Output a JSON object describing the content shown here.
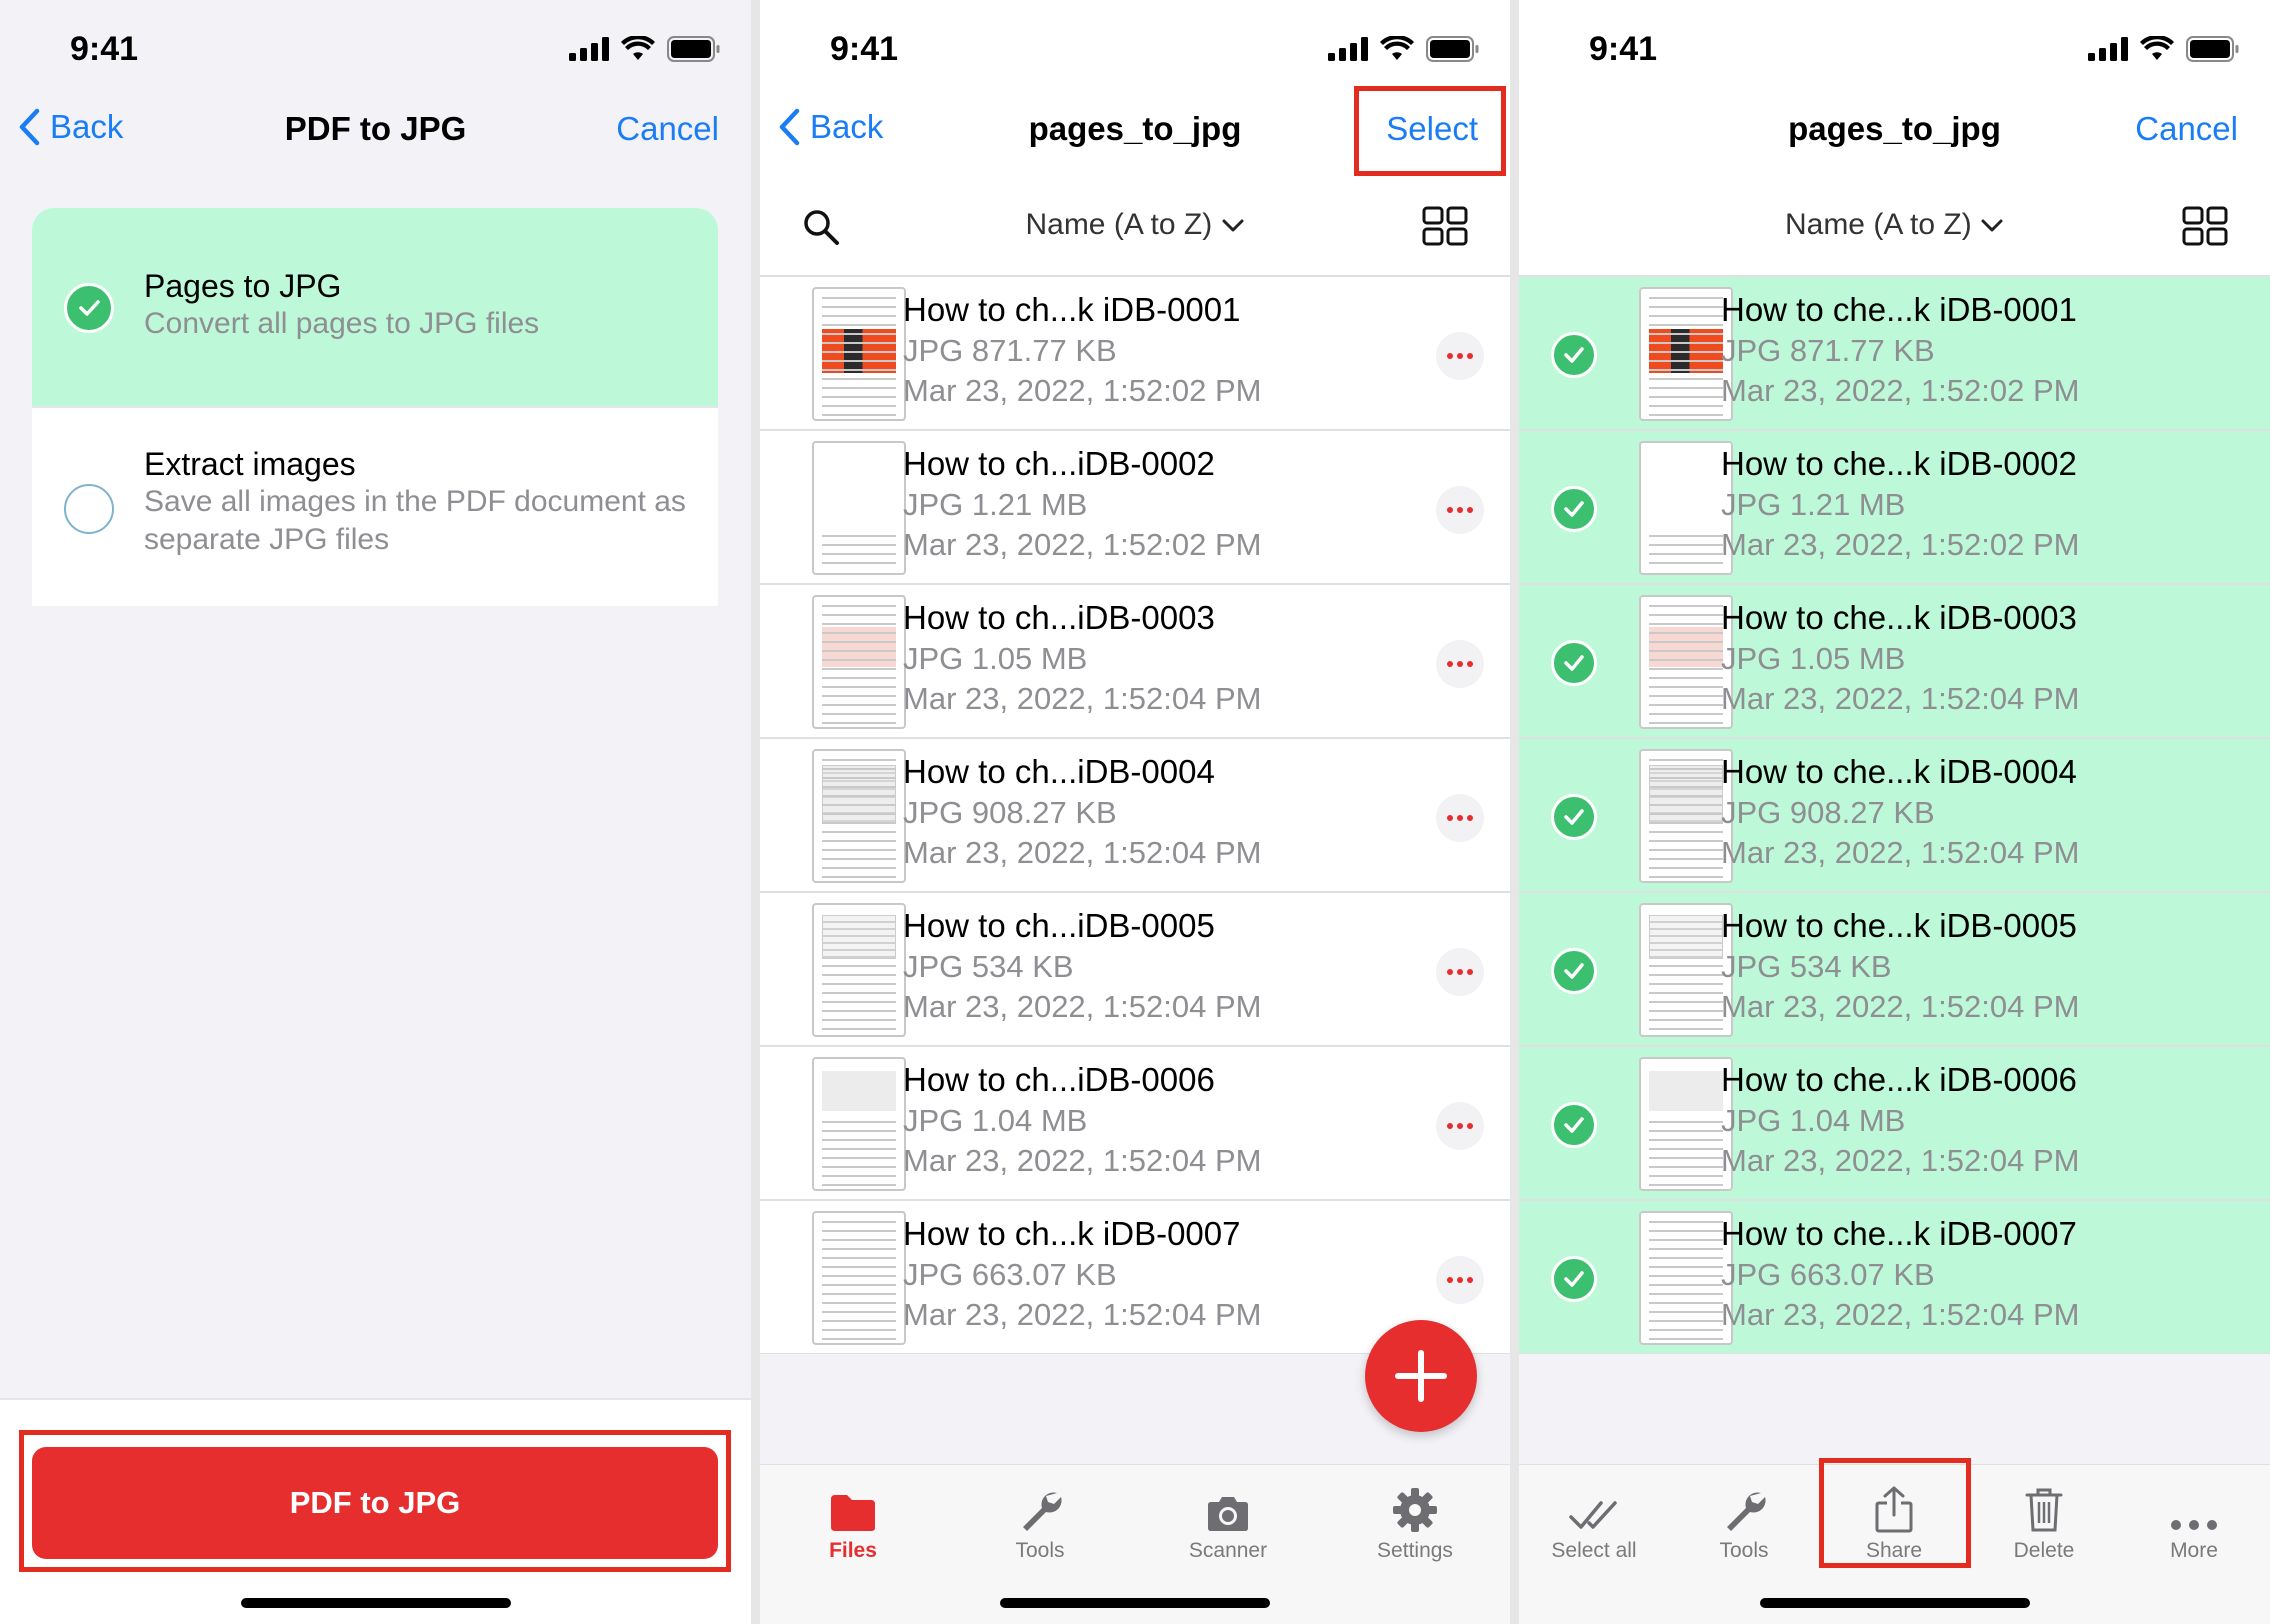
{
  "status": {
    "time": "9:41"
  },
  "screen1": {
    "nav": {
      "back": "Back",
      "title": "PDF to JPG",
      "cancel": "Cancel"
    },
    "options": [
      {
        "title": "Pages to JPG",
        "subtitle": "Convert all pages to JPG files",
        "selected": true
      },
      {
        "title": "Extract images",
        "subtitle": "Save all images in the PDF document as separate JPG files",
        "selected": false
      }
    ],
    "button": "PDF to JPG"
  },
  "screen2": {
    "nav": {
      "back": "Back",
      "title": "pages_to_jpg",
      "select": "Select"
    },
    "sort": "Name (A to Z)",
    "files": [
      {
        "name": "How to ch...k iDB-0001",
        "meta": "JPG 871.77 KB",
        "date": "Mar 23, 2022, 1:52:02 PM"
      },
      {
        "name": "How to ch...iDB-0002",
        "meta": "JPG 1.21 MB",
        "date": "Mar 23, 2022, 1:52:02 PM"
      },
      {
        "name": "How to ch...iDB-0003",
        "meta": "JPG 1.05 MB",
        "date": "Mar 23, 2022, 1:52:04 PM"
      },
      {
        "name": "How to ch...iDB-0004",
        "meta": "JPG 908.27 KB",
        "date": "Mar 23, 2022, 1:52:04 PM"
      },
      {
        "name": "How to ch...iDB-0005",
        "meta": "JPG 534 KB",
        "date": "Mar 23, 2022, 1:52:04 PM"
      },
      {
        "name": "How to ch...iDB-0006",
        "meta": "JPG 1.04 MB",
        "date": "Mar 23, 2022, 1:52:04 PM"
      },
      {
        "name": "How to ch...k iDB-0007",
        "meta": "JPG 663.07 KB",
        "date": "Mar 23, 2022, 1:52:04 PM"
      }
    ],
    "tabs": [
      {
        "label": "Files",
        "icon": "folder-icon"
      },
      {
        "label": "Tools",
        "icon": "wrench-icon"
      },
      {
        "label": "Scanner",
        "icon": "camera-icon"
      },
      {
        "label": "Settings",
        "icon": "gear-icon"
      }
    ]
  },
  "screen3": {
    "nav": {
      "title": "pages_to_jpg",
      "cancel": "Cancel"
    },
    "sort": "Name (A to Z)",
    "files": [
      {
        "name": "How to che...k iDB-0001",
        "meta": "JPG 871.77 KB",
        "date": "Mar 23, 2022, 1:52:02 PM"
      },
      {
        "name": "How to che...k iDB-0002",
        "meta": "JPG 1.21 MB",
        "date": "Mar 23, 2022, 1:52:02 PM"
      },
      {
        "name": "How to che...k iDB-0003",
        "meta": "JPG 1.05 MB",
        "date": "Mar 23, 2022, 1:52:04 PM"
      },
      {
        "name": "How to che...k iDB-0004",
        "meta": "JPG 908.27 KB",
        "date": "Mar 23, 2022, 1:52:04 PM"
      },
      {
        "name": "How to che...k iDB-0005",
        "meta": "JPG 534 KB",
        "date": "Mar 23, 2022, 1:52:04 PM"
      },
      {
        "name": "How to che...k iDB-0006",
        "meta": "JPG 1.04 MB",
        "date": "Mar 23, 2022, 1:52:04 PM"
      },
      {
        "name": "How to che...k iDB-0007",
        "meta": "JPG 663.07 KB",
        "date": "Mar 23, 2022, 1:52:04 PM"
      }
    ],
    "actions": [
      {
        "label": "Select all",
        "icon": "double-check-icon"
      },
      {
        "label": "Tools",
        "icon": "wrench-icon"
      },
      {
        "label": "Share",
        "icon": "share-icon"
      },
      {
        "label": "Delete",
        "icon": "trash-icon"
      },
      {
        "label": "More",
        "icon": "more-icon"
      }
    ]
  },
  "colors": {
    "accent_blue": "#1a7df5",
    "brand_red": "#e62e2e",
    "selection_green": "#bdf9d8",
    "check_green": "#3cbf6e",
    "highlight_red": "#e32b1f"
  }
}
